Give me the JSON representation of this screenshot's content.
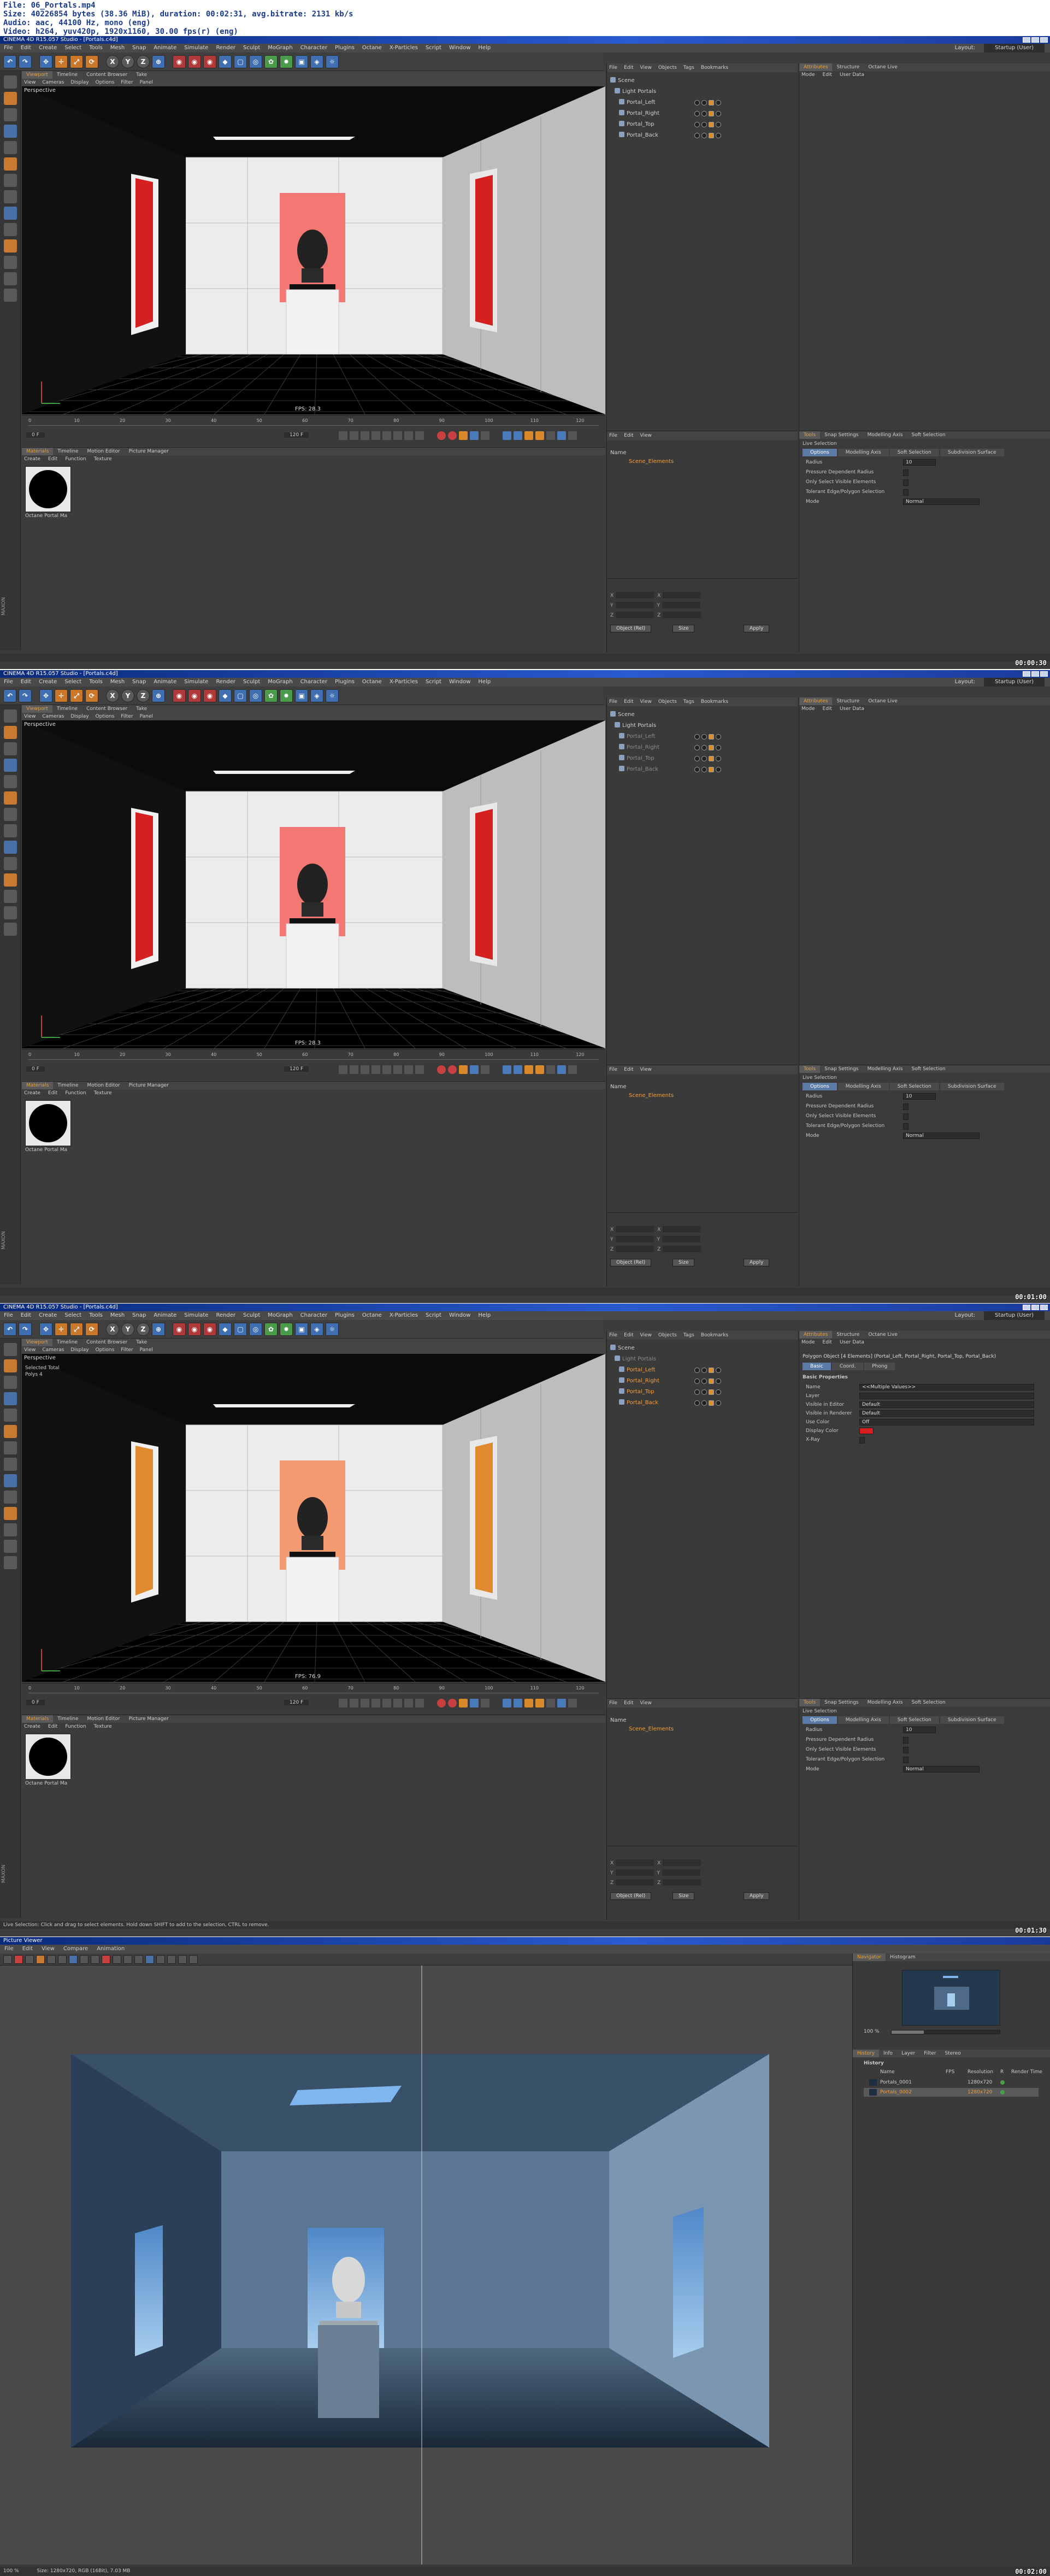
{
  "meta": {
    "line1": "File: 06_Portals.mp4",
    "line2": "Size: 40226854 bytes (38.36 MiB), duration: 00:02:31, avg.bitrate: 2131 kb/s",
    "line3": "Audio: aac, 44100 Hz, mono (eng)",
    "line4": "Video: h264, yuv420p, 1920x1160, 30.00 fps(r) (eng)"
  },
  "app": {
    "title": "CINEMA 4D R15.057 Studio - [Portals.c4d]",
    "menu": [
      "File",
      "Edit",
      "Create",
      "Select",
      "Tools",
      "Mesh",
      "Snap",
      "Animate",
      "Simulate",
      "Render",
      "Sculpt",
      "MoGraph",
      "Character",
      "Plugins",
      "Octane",
      "X-Particles",
      "Script",
      "Window",
      "Help"
    ],
    "layout_label": "Layout:",
    "layout_value": "Startup (User)",
    "viewport_menu": [
      "View",
      "Cameras",
      "Display",
      "Options",
      "Filter",
      "Panel"
    ],
    "viewport_tabs": [
      "Viewport",
      "Timeline",
      "Content Browser",
      "Take"
    ],
    "viewport_label": "Perspective",
    "object_menu": [
      "File",
      "Edit",
      "View",
      "Objects",
      "Tags",
      "Bookmarks"
    ],
    "layer_menu": [
      "File",
      "Edit",
      "View"
    ],
    "layer_col": "Name",
    "layer_row": "Scene_Elements",
    "material_tabs": [
      "Materials",
      "Timeline",
      "Motion Editor",
      "Picture Manager"
    ],
    "material_menu": [
      "Create",
      "Edit",
      "Function",
      "Texture"
    ],
    "material_name": "Octane Portal Ma",
    "coord_btn_world": "Object (Rel)",
    "coord_btn_size": "Size",
    "coord_btn_apply": "Apply",
    "attr_tabs": [
      "Attributes",
      "Structure",
      "Octane Live"
    ],
    "attr_menu": [
      "Mode",
      "Edit",
      "User Data"
    ],
    "live_selection": "Live Selection",
    "tool_tabs": [
      "Tools",
      "Snap Settings",
      "Modelling Axis",
      "Soft Selection"
    ],
    "tool_subtabs": [
      "Options",
      "Modelling Axis",
      "Soft Selection",
      "Subdivision Surface"
    ],
    "tool_section": "Options",
    "tool_rows": [
      {
        "label": "Radius",
        "value": "10"
      },
      {
        "label": "Pressure Dependent Radius",
        "value": ""
      },
      {
        "label": "Only Select Visible Elements",
        "value": ""
      },
      {
        "label": "Tolerant Edge/Polygon Selection",
        "value": ""
      },
      {
        "label": "Mode",
        "value": "Normal"
      }
    ],
    "tl_ticks": [
      "0",
      "10",
      "20",
      "30",
      "40",
      "50",
      "60",
      "70",
      "80",
      "90",
      "100",
      "110",
      "120"
    ],
    "tl_frame": "0 F",
    "tl_end": "120 F",
    "vendor": "MAXON"
  },
  "frames": [
    {
      "timestamp": "00:00:30",
      "fps": "FPS: 28.3",
      "objects": [
        {
          "label": "Scene",
          "state": "normal"
        },
        {
          "label": "Light Portals",
          "state": "normal"
        },
        {
          "label": "Portal_Left",
          "state": "normal"
        },
        {
          "label": "Portal_Right",
          "state": "normal"
        },
        {
          "label": "Portal_Top",
          "state": "normal"
        },
        {
          "label": "Portal_Back",
          "state": "normal"
        }
      ],
      "status": ""
    },
    {
      "timestamp": "00:01:00",
      "fps": "FPS: 28.3",
      "objects": [
        {
          "label": "Scene",
          "state": "normal"
        },
        {
          "label": "Light Portals",
          "state": "normal"
        },
        {
          "label": "Portal_Left",
          "state": "dim"
        },
        {
          "label": "Portal_Right",
          "state": "dim"
        },
        {
          "label": "Portal_Top",
          "state": "dim"
        },
        {
          "label": "Portal_Back",
          "state": "dim"
        }
      ],
      "status": ""
    },
    {
      "timestamp": "00:01:30",
      "fps": "FPS: 76.9",
      "objects": [
        {
          "label": "Scene",
          "state": "normal"
        },
        {
          "label": "Light Portals",
          "state": "dim"
        },
        {
          "label": "Portal_Left",
          "state": "sel"
        },
        {
          "label": "Portal_Right",
          "state": "sel"
        },
        {
          "label": "Portal_Top",
          "state": "sel"
        },
        {
          "label": "Portal_Back",
          "state": "sel"
        }
      ],
      "status": "Live Selection: Click and drag to select elements. Hold down SHIFT to add to the selection, CTRL to remove.",
      "vp_info": [
        "Selected Total",
        "Polys  4"
      ],
      "attr_header": "Polygon Object [4 Elements] (Portal_Left, Portal_Right, Portal_Top, Portal_Back)",
      "attr_subtabs": [
        "Basic",
        "Coord.",
        "Phong"
      ],
      "attr_section": "Basic Properties",
      "attr_rows": [
        {
          "label": "Name",
          "value": "<<Multiple Values>>"
        },
        {
          "label": "Layer",
          "value": ""
        },
        {
          "label": "Visible in Editor",
          "value": "Default"
        },
        {
          "label": "Visible in Renderer",
          "value": "Default"
        },
        {
          "label": "Use Color",
          "value": "Off"
        },
        {
          "label": "Display Color",
          "value": ""
        },
        {
          "label": "X-Ray",
          "value": ""
        }
      ]
    }
  ],
  "picture_viewer": {
    "title": "Picture Viewer",
    "menu": [
      "File",
      "Edit",
      "View",
      "Compare",
      "Animation"
    ],
    "nav_tabs": [
      "Navigator",
      "Histogram"
    ],
    "zoom": "100 %",
    "hist_tabs": [
      "History",
      "Info",
      "Layer",
      "Filter",
      "Stereo"
    ],
    "hist_section": "History",
    "hist_cols": [
      "Name",
      "FPS",
      "Resolution",
      "R",
      "Render Time"
    ],
    "hist_rows": [
      {
        "name": "Portals_0001",
        "res": "1280x720",
        "sel": false
      },
      {
        "name": "Portals_0002",
        "res": "1280x720",
        "sel": true
      }
    ],
    "status": "Size: 1280x720, RGB (16Bit), 7.03 MB",
    "zoom_status": "100 %",
    "timestamp": "00:02:00"
  },
  "colors": {
    "accent_orange": "#f0a040",
    "portal_red": "#d42020",
    "portal_orange": "#e08a30"
  }
}
